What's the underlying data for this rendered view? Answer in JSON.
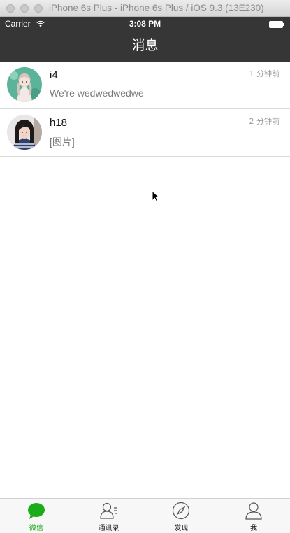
{
  "window": {
    "title": "iPhone 6s Plus - iPhone 6s Plus / iOS 9.3 (13E230)"
  },
  "status_bar": {
    "carrier": "Carrier",
    "time": "3:08 PM",
    "icons": [
      "wifi-icon",
      "battery-icon"
    ]
  },
  "nav": {
    "title": "消息"
  },
  "messages": [
    {
      "name": "i4",
      "preview": "We're wedwedwedwe",
      "time": "1 分钟前",
      "avatar": "anime-girl-avatar"
    },
    {
      "name": "h18",
      "preview": "[图片]",
      "time": "2 分钟前",
      "avatar": "photo-girl-avatar"
    }
  ],
  "tabs": [
    {
      "label": "微信",
      "icon": "chat-bubble-icon",
      "active": true
    },
    {
      "label": "通讯录",
      "icon": "contacts-icon",
      "active": false
    },
    {
      "label": "发现",
      "icon": "compass-icon",
      "active": false
    },
    {
      "label": "我",
      "icon": "person-icon",
      "active": false
    }
  ],
  "colors": {
    "nav_background": "#363636",
    "active_tab": "#1aad19",
    "tab_bar_background": "#f7f7f7"
  }
}
